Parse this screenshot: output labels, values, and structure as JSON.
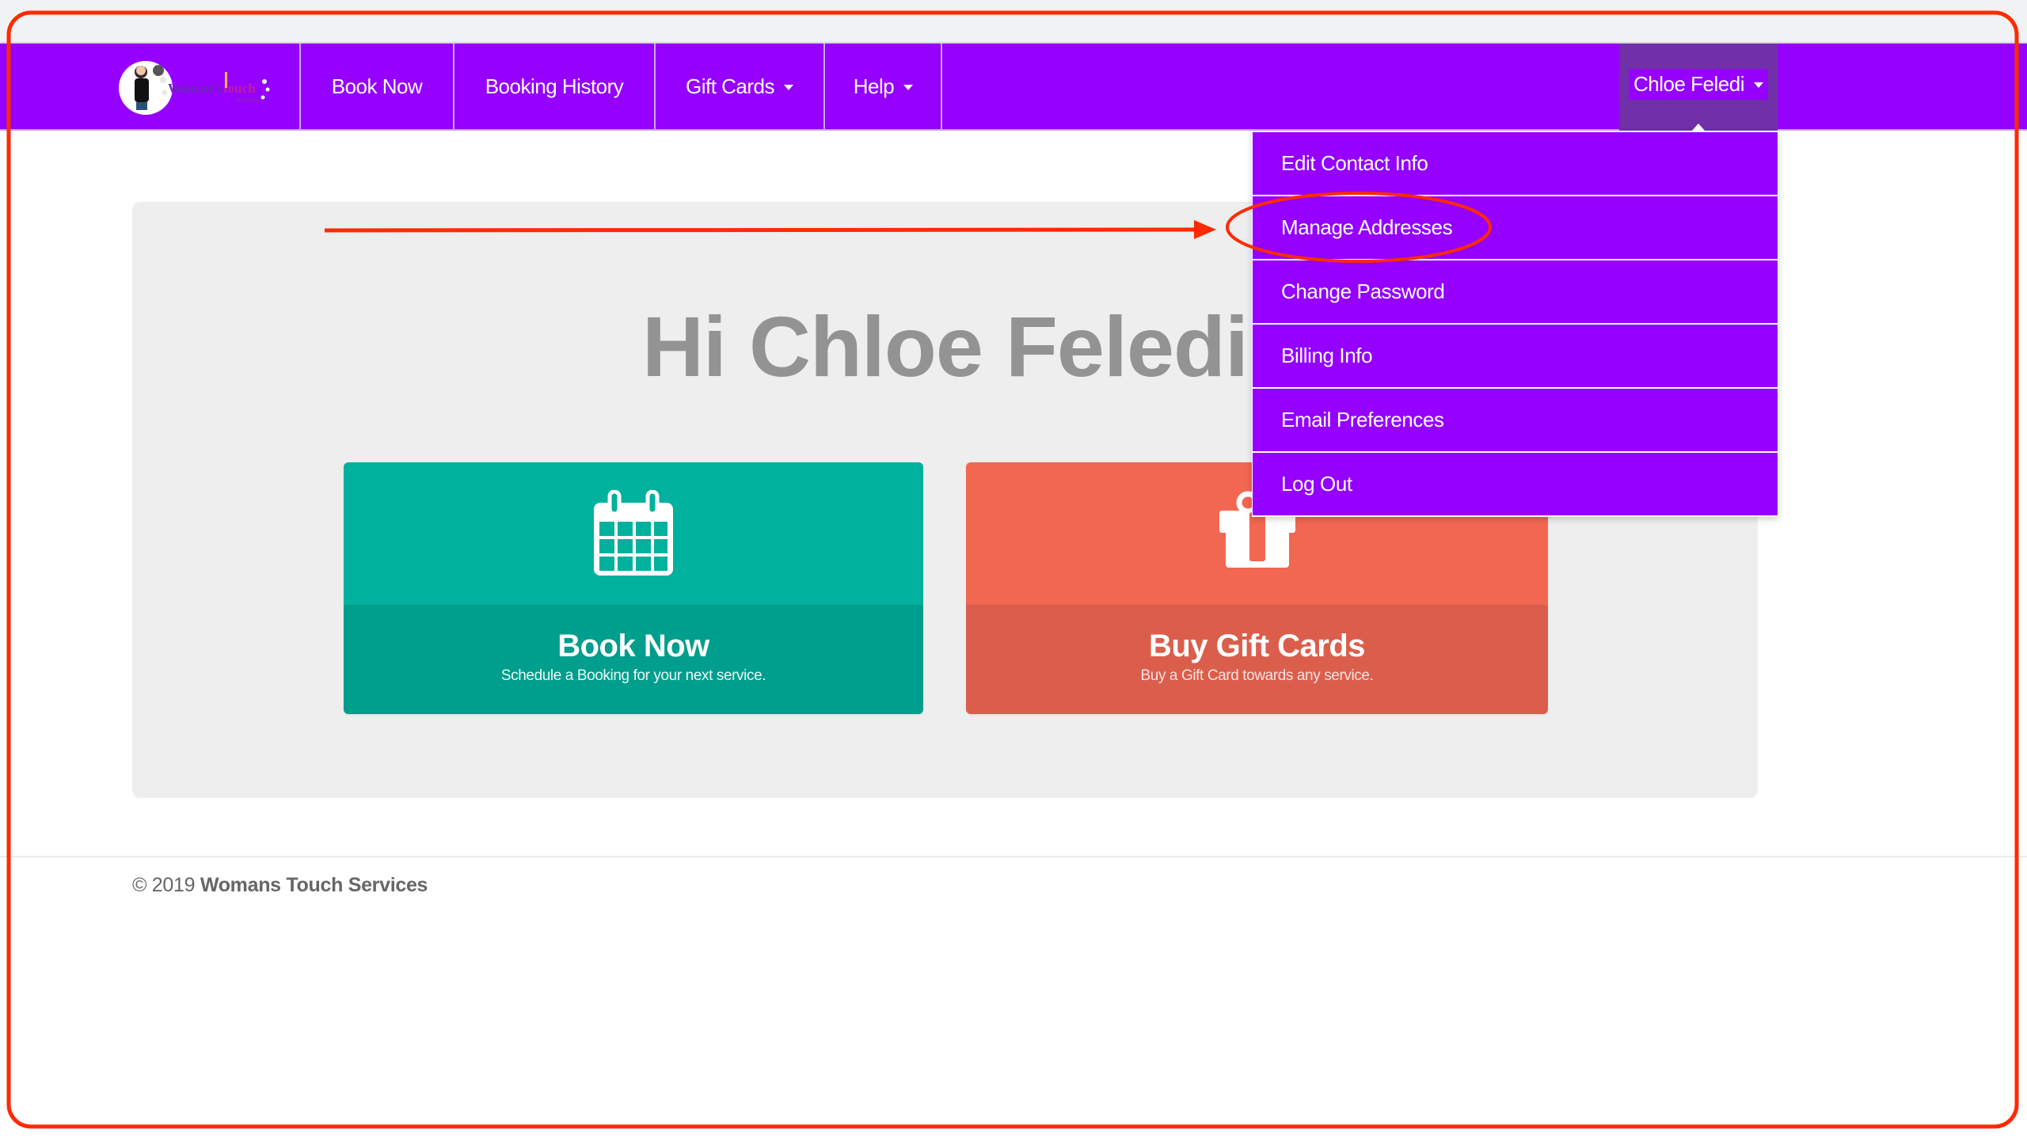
{
  "nav": {
    "logo_alt": "Woman's Touch services logo",
    "items": [
      {
        "label": "Book Now",
        "has_caret": false
      },
      {
        "label": "Booking History",
        "has_caret": false
      },
      {
        "label": "Gift Cards",
        "has_caret": true
      },
      {
        "label": "Help",
        "has_caret": true
      }
    ],
    "user_name": "Chloe Feledi"
  },
  "user_dropdown": {
    "items": [
      {
        "label": "Edit Contact Info"
      },
      {
        "label": "Manage Addresses",
        "highlighted": true
      },
      {
        "label": "Change Password"
      },
      {
        "label": "Billing Info"
      },
      {
        "label": "Email Preferences"
      },
      {
        "label": "Log Out"
      }
    ]
  },
  "main": {
    "greeting": "Hi Chloe Feledi",
    "cards": [
      {
        "title": "Book Now",
        "subtitle": "Schedule a Booking for your next service.",
        "icon": "calendar-icon"
      },
      {
        "title": "Buy Gift Cards",
        "subtitle": "Buy a Gift Card towards any service.",
        "icon": "gift-icon"
      }
    ]
  },
  "footer": {
    "copyright": "© 2019",
    "company": "Womans Touch Services"
  },
  "colors": {
    "nav_purple": "#9500ff",
    "user_menu_active": "#7030a8",
    "book_card_top": "#00b19d",
    "book_card_bottom": "#009e8c",
    "gift_card_top": "#f26752",
    "gift_card_bottom": "#db5e4c",
    "annotation_red": "#ff2a00"
  }
}
